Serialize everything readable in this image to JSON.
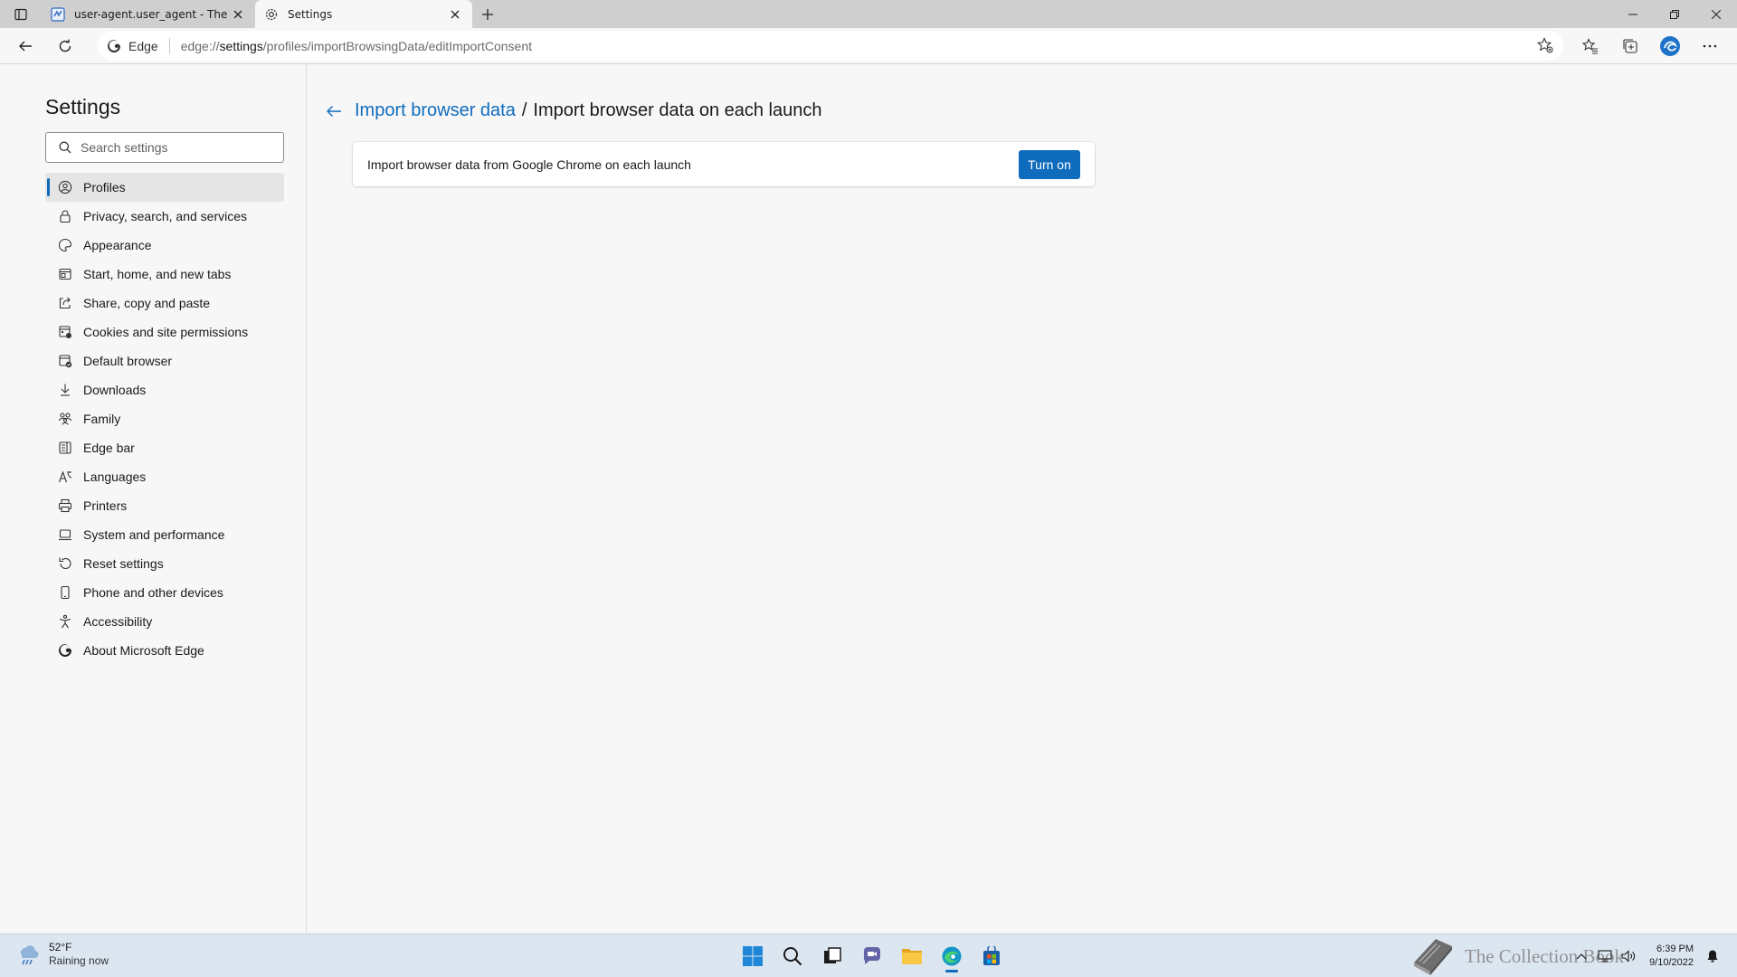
{
  "tabs": [
    {
      "title": "user-agent.user_agent - The Coll",
      "active": false
    },
    {
      "title": "Settings",
      "active": true
    }
  ],
  "address": {
    "chip": "Edge",
    "url_prefix": "edge://",
    "url_host": "settings",
    "url_path": "/profiles/importBrowsingData/editImportConsent"
  },
  "sidebar": {
    "title": "Settings",
    "search_placeholder": "Search settings",
    "items": [
      {
        "label": "Profiles",
        "icon": "profile-icon",
        "selected": true
      },
      {
        "label": "Privacy, search, and services",
        "icon": "lock-icon"
      },
      {
        "label": "Appearance",
        "icon": "palette-icon"
      },
      {
        "label": "Start, home, and new tabs",
        "icon": "window-icon"
      },
      {
        "label": "Share, copy and paste",
        "icon": "share-icon"
      },
      {
        "label": "Cookies and site permissions",
        "icon": "cookies-icon"
      },
      {
        "label": "Default browser",
        "icon": "default-browser-icon"
      },
      {
        "label": "Downloads",
        "icon": "download-icon"
      },
      {
        "label": "Family",
        "icon": "family-icon"
      },
      {
        "label": "Edge bar",
        "icon": "edge-bar-icon"
      },
      {
        "label": "Languages",
        "icon": "languages-icon"
      },
      {
        "label": "Printers",
        "icon": "printer-icon"
      },
      {
        "label": "System and performance",
        "icon": "laptop-icon"
      },
      {
        "label": "Reset settings",
        "icon": "reset-icon"
      },
      {
        "label": "Phone and other devices",
        "icon": "phone-icon"
      },
      {
        "label": "Accessibility",
        "icon": "accessibility-icon"
      },
      {
        "label": "About Microsoft Edge",
        "icon": "edge-logo-icon"
      }
    ]
  },
  "main": {
    "breadcrumb_parent": "Import browser data",
    "breadcrumb_separator": "/",
    "breadcrumb_current": "Import browser data on each launch",
    "card_text": "Import browser data from Google Chrome on each launch",
    "card_button": "Turn on"
  },
  "taskbar": {
    "weather_temp": "52°F",
    "weather_condition": "Raining now",
    "watermark": "The Collection Book",
    "time": "6:39 PM",
    "date": "9/10/2022"
  },
  "colors": {
    "accent": "#0f6cbd",
    "tab_strip": "#cfcfcf",
    "page_bg": "#f7f7f7"
  }
}
